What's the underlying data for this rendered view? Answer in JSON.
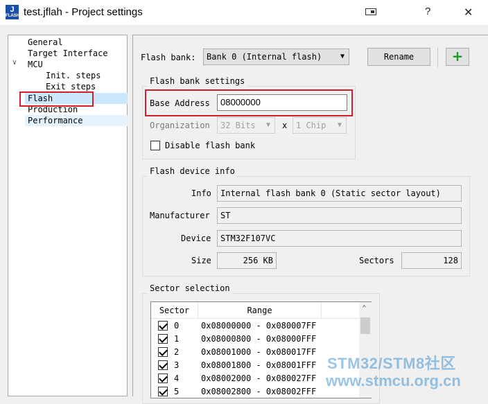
{
  "window": {
    "title": "test.jflah - Project settings",
    "app_icon_letter": "J",
    "app_icon_sub": "FLASH",
    "help_label": "?",
    "close_label": "✕"
  },
  "tree": {
    "items": [
      {
        "label": "General"
      },
      {
        "label": "Target Interface"
      },
      {
        "label": "MCU"
      },
      {
        "label": "Init. steps"
      },
      {
        "label": "Exit steps"
      },
      {
        "label": "Flash"
      },
      {
        "label": "Production"
      },
      {
        "label": "Performance"
      }
    ],
    "expand_arrow": "✔"
  },
  "flash_bank": {
    "label": "Flash bank:",
    "selected": "Bank 0 (Internal flash)",
    "rename_label": "Rename",
    "add_label": "+"
  },
  "bank_settings": {
    "title": "Flash bank settings",
    "base_address_label": "Base Address",
    "base_address_value": "08000000",
    "organization_label": "Organization",
    "organization_bits": "32 Bits",
    "organization_x": "x",
    "organization_chip": "1 Chip",
    "disable_label": "Disable flash bank"
  },
  "device_info": {
    "title": "Flash device info",
    "info_label": "Info",
    "info_value": "Internal flash bank 0 (Static sector layout)",
    "manufacturer_label": "Manufacturer",
    "manufacturer_value": "ST",
    "device_label": "Device",
    "device_value": "STM32F107VC",
    "size_label": "Size",
    "size_value": "256 KB",
    "sectors_label": "Sectors",
    "sectors_value": "128"
  },
  "sector_selection": {
    "title": "Sector selection",
    "columns": [
      "Sector",
      "Range"
    ],
    "rows": [
      {
        "sector": "0",
        "range": "0x08000000 - 0x080007FF"
      },
      {
        "sector": "1",
        "range": "0x08000800 - 0x08000FFF"
      },
      {
        "sector": "2",
        "range": "0x08001000 - 0x080017FF"
      },
      {
        "sector": "3",
        "range": "0x08001800 - 0x08001FFF"
      },
      {
        "sector": "4",
        "range": "0x08002000 - 0x080027FF"
      },
      {
        "sector": "5",
        "range": "0x08002800 - 0x08002FFF"
      }
    ]
  },
  "watermark": {
    "line1": "STM32/STM8社区",
    "line2": "www.stmcu.org.cn"
  },
  "colors": {
    "highlight_box": "#d0202a",
    "selected_item": "#cce8ff",
    "add_button_plus": "#1a9a2a"
  }
}
